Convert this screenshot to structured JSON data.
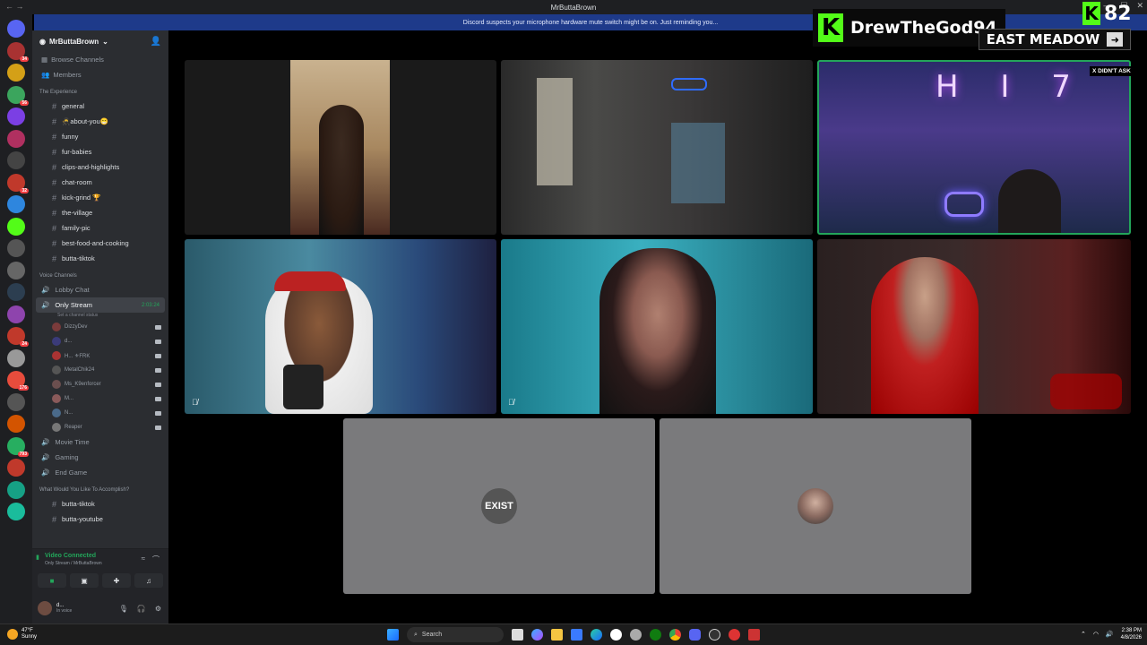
{
  "window": {
    "title": "MrButtaBrown"
  },
  "banner": {
    "text": "Discord suspects your microphone hardware mute switch might be on. Just reminding you..."
  },
  "server_rail": {
    "items": [
      {
        "color": "#5865f2",
        "badge": ""
      },
      {
        "color": "#a83232",
        "badge": "34"
      },
      {
        "color": "#d4a017",
        "badge": ""
      },
      {
        "color": "#3ba55d",
        "badge": "56"
      },
      {
        "color": "#7b3fe4",
        "badge": ""
      },
      {
        "color": "#b03060",
        "badge": ""
      },
      {
        "color": "#444",
        "badge": ""
      },
      {
        "color": "#c0392b",
        "badge": "32"
      },
      {
        "color": "#2e86de",
        "badge": ""
      },
      {
        "color": "#53fc18",
        "badge": ""
      },
      {
        "color": "#555",
        "badge": ""
      },
      {
        "color": "#666",
        "badge": ""
      },
      {
        "color": "#2c3e50",
        "badge": ""
      },
      {
        "color": "#8e44ad",
        "badge": ""
      },
      {
        "color": "#c0392b",
        "badge": "24"
      },
      {
        "color": "#999",
        "badge": ""
      },
      {
        "color": "#e74c3c",
        "badge": "176"
      },
      {
        "color": "#555",
        "badge": ""
      },
      {
        "color": "#d35400",
        "badge": ""
      },
      {
        "color": "#27ae60",
        "badge": "793"
      },
      {
        "color": "#c0392b",
        "badge": ""
      },
      {
        "color": "#16a085",
        "badge": ""
      },
      {
        "color": "#1abc9c",
        "badge": ""
      }
    ]
  },
  "sidebar": {
    "guild_name": "MrButtaBrown",
    "nav": [
      {
        "label": "Browse Channels"
      },
      {
        "label": "Members"
      }
    ],
    "category_experience": "The Experience",
    "text_channels": [
      {
        "label": "general"
      },
      {
        "label": "🥷about-you😁"
      },
      {
        "label": "funny"
      },
      {
        "label": "fur-babies"
      },
      {
        "label": "clips-and-highlights"
      },
      {
        "label": "chat-room"
      },
      {
        "label": "kick-grind 🏆"
      },
      {
        "label": "the-village"
      },
      {
        "label": "family-pic"
      },
      {
        "label": "best-food-and-cooking"
      },
      {
        "label": "butta-tiktok"
      }
    ],
    "category_voice": "Voice Channels",
    "voice_lobby": "Lobby Chat",
    "voice_active": {
      "label": "Only Stream",
      "timer": "2:03:24",
      "status": "Set a channel status"
    },
    "voice_users": [
      {
        "name": "DizzyDev",
        "color": "#7a3b3b"
      },
      {
        "name": "d...",
        "color": "#3b3b7a"
      },
      {
        "name": "H... ⚜FRK",
        "color": "#a33"
      },
      {
        "name": "MetalChik24",
        "color": "#555"
      },
      {
        "name": "Ms_K9enforcer",
        "color": "#6b4f4f"
      },
      {
        "name": "M...",
        "color": "#8a5a5a"
      },
      {
        "name": "N...",
        "color": "#4a6a8a"
      },
      {
        "name": "Reaper",
        "color": "#777"
      }
    ],
    "voice_more": [
      {
        "label": "Movie Time"
      },
      {
        "label": "Gaming"
      },
      {
        "label": "End Game"
      }
    ],
    "category_accomplish": "What Would You Like To Accomplish?",
    "more_text_channels": [
      {
        "label": "butta-tiktok"
      },
      {
        "label": "butta-youtube"
      }
    ]
  },
  "voice_panel": {
    "status": "Video Connected",
    "sub": "Only Stream / MrButtaBrown"
  },
  "user_panel": {
    "name": "d...",
    "status": "In voice"
  },
  "overlay": {
    "streamer": "DrewTheGod94",
    "viewer_count": "82",
    "meadow": "EAST MEADOW",
    "tag": "X DIDN'T ASK"
  },
  "tiles": [
    {
      "avatar_text": ""
    },
    {
      "avatar_text": ""
    },
    {
      "avatar_text": "H I 7"
    },
    {
      "avatar_text": ""
    },
    {
      "avatar_text": ""
    },
    {
      "avatar_text": ""
    },
    {
      "avatar_text": "EXIST"
    },
    {
      "avatar_text": ""
    }
  ],
  "taskbar": {
    "weather_temp": "47°F",
    "weather_desc": "Sunny",
    "search_placeholder": "Search",
    "time": "2:38 PM",
    "date": "4/8/2026"
  }
}
